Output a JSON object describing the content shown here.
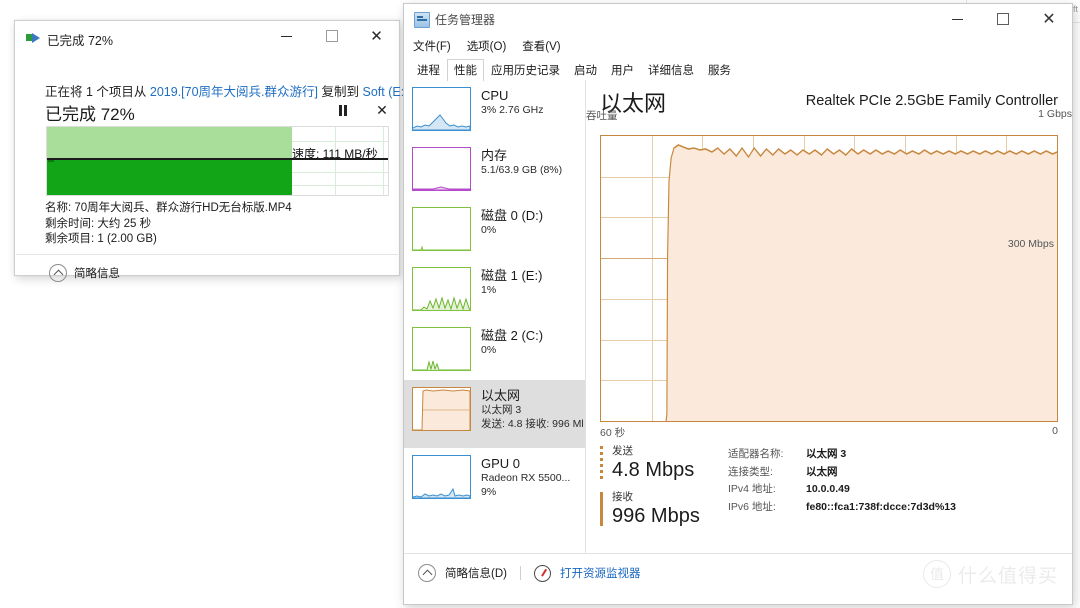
{
  "copy_dialog": {
    "title": "已完成 72%",
    "icon": "copy-file-icon",
    "line1_prefix": "正在将 1 个项目从",
    "line1_source": "2019.[70周年大阅兵.群众游行]",
    "line1_mid": "复制到",
    "line1_dest": "Soft (E:)",
    "percent_label": "已完成 72%",
    "progress_percent": 72,
    "speed": "速度: 111 MB/秒",
    "detail_name": "名称: 70周年大阅兵、群众游行HD无台标版.MP4",
    "detail_time": "剩余时间: 大约 25 秒",
    "detail_items": "剩余项目: 1 (2.00 GB)",
    "footer_label": "简略信息",
    "minimize": "—",
    "maximize": "□",
    "close": "✕",
    "pause": "pause-icon",
    "cancel": "✕"
  },
  "behind_window": {
    "cells": "⌄  ⌃  ⚙",
    "text": "搜索\"Soft"
  },
  "task_manager": {
    "title": "任务管理器",
    "icon": "task-manager-icon",
    "window_buttons": {
      "minimize": "—",
      "maximize": "□",
      "close": "✕"
    },
    "menu": [
      "文件(F)",
      "选项(O)",
      "查看(V)"
    ],
    "tabs": [
      {
        "label": "进程",
        "active": false
      },
      {
        "label": "性能",
        "active": true
      },
      {
        "label": "应用历史记录",
        "active": false
      },
      {
        "label": "启动",
        "active": false
      },
      {
        "label": "用户",
        "active": false
      },
      {
        "label": "详细信息",
        "active": false
      },
      {
        "label": "服务",
        "active": false
      }
    ],
    "sidebar": [
      {
        "name": "CPU",
        "detail": "3% 2.76 GHz",
        "detail2": "",
        "color": "#3a8fd0",
        "selected": false
      },
      {
        "name": "内存",
        "detail": "5.1/63.9 GB (8%)",
        "detail2": "",
        "color": "#b44bc8",
        "selected": false
      },
      {
        "name": "磁盘 0 (D:)",
        "detail": "0%",
        "detail2": "",
        "color": "#7ec23f",
        "selected": false
      },
      {
        "name": "磁盘 1 (E:)",
        "detail": "1%",
        "detail2": "",
        "color": "#7ec23f",
        "selected": false
      },
      {
        "name": "磁盘 2 (C:)",
        "detail": "0%",
        "detail2": "",
        "color": "#7ec23f",
        "selected": false
      },
      {
        "name": "以太网",
        "detail": "以太网 3",
        "detail2": "发送: 4.8 接收: 996 Ml",
        "color": "#c8873e",
        "selected": true
      },
      {
        "name": "GPU 0",
        "detail": "Radeon RX 5500...",
        "detail2": "9%",
        "color": "#3a8fd0",
        "selected": false
      }
    ],
    "main": {
      "title": "以太网",
      "adapter": "Realtek PCIe 2.5GbE Family Controller",
      "axis_label": "吞吐量",
      "axis_max": "1 Gbps",
      "gridline_label": "300 Mbps",
      "x_left": "60 秒",
      "x_right": "0"
    },
    "stats": {
      "send_label": "发送",
      "send_value": "4.8 Mbps",
      "recv_label": "接收",
      "recv_value": "996 Mbps",
      "rows": [
        {
          "key": "适配器名称:",
          "value": "以太网 3"
        },
        {
          "key": "连接类型:",
          "value": "以太网"
        },
        {
          "key": "IPv4 地址:",
          "value": "10.0.0.49"
        },
        {
          "key": "IPv6 地址:",
          "value": "fe80::fca1:738f:dcce:7d3d%13"
        }
      ]
    },
    "footer": {
      "fewer_details": "简略信息(D)",
      "resource_monitor": "打开资源监视器",
      "resource_monitor_icon": "resource-monitor-icon"
    }
  },
  "watermark": {
    "badge": "值",
    "text": "什么值得买"
  },
  "chart_data": {
    "type": "area",
    "title": "以太网 吞吐量",
    "ylabel": "吞吐量",
    "xlabel": "",
    "ylim": [
      0,
      1000
    ],
    "ylim_unit": "Mbps",
    "axis_max_label": "1 Gbps",
    "gridline_labels": [
      "300 Mbps"
    ],
    "x_range_seconds": 60,
    "x_left_label": "60 秒",
    "x_right_label": "0",
    "line_color": "#c8873e",
    "fill_color": "#fbeadc",
    "grid": true,
    "series": [
      {
        "name": "吞吐量",
        "unit": "Mbps",
        "values": [
          0,
          0,
          0,
          0,
          0,
          0,
          0,
          0,
          0,
          0,
          0,
          0,
          0,
          0,
          0,
          0,
          0,
          0,
          350,
          880,
          960,
          985,
          970,
          962,
          958,
          955,
          952,
          950,
          948,
          947,
          950,
          946,
          944,
          952,
          940,
          950,
          935,
          948,
          938,
          952,
          930,
          948,
          935,
          950,
          940,
          948,
          932,
          946,
          936,
          950,
          942,
          948,
          936,
          944,
          938,
          946,
          940,
          944,
          938,
          946
        ]
      }
    ]
  }
}
